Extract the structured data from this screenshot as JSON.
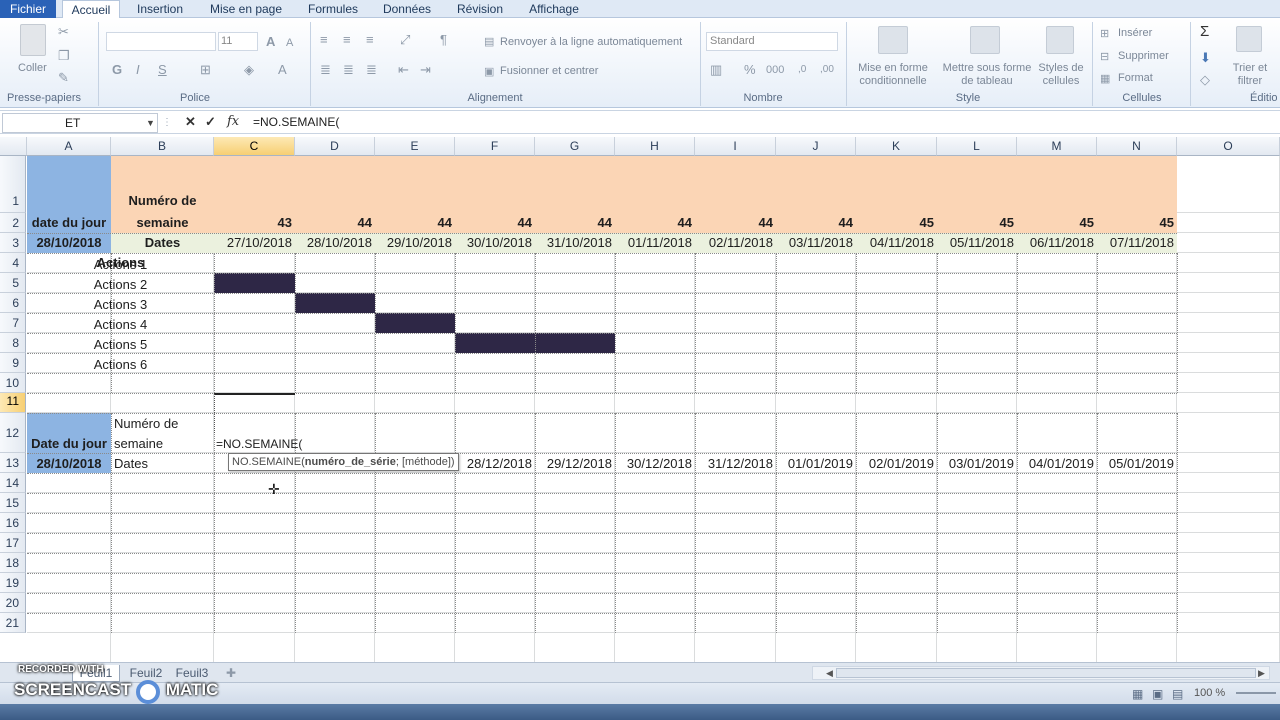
{
  "tabs": [
    "Fichier",
    "Accueil",
    "Insertion",
    "Mise en page",
    "Formules",
    "Données",
    "Révision",
    "Affichage"
  ],
  "ribbon": {
    "coller": "Coller",
    "font_size": "11",
    "wrap_text": "Renvoyer à la ligne automatiquement",
    "merge": "Fusionner et centrer",
    "number_format": "Standard",
    "cond_format": "Mise en forme\nconditionnelle",
    "table_format": "Mettre sous forme\nde tableau",
    "cell_styles": "Styles de\ncellules",
    "insert": "Insérer",
    "delete": "Supprimer",
    "format": "Format",
    "sort": "Trier et\nfiltrer",
    "groups": [
      "Presse-papiers",
      "Police",
      "Alignement",
      "Nombre",
      "Style",
      "Cellules",
      "Éditio"
    ]
  },
  "formula_bar": {
    "name_box": "ET",
    "formula": "=NO.SEMAINE("
  },
  "columns": [
    "A",
    "B",
    "C",
    "D",
    "E",
    "F",
    "G",
    "H",
    "I",
    "J",
    "K",
    "L",
    "M",
    "N",
    "O"
  ],
  "rows": [
    "1",
    "2",
    "3",
    "4",
    "5",
    "6",
    "7",
    "8",
    "9",
    "10",
    "11",
    "12",
    "13",
    "14",
    "15",
    "16",
    "17",
    "18",
    "19",
    "20",
    "21"
  ],
  "table1": {
    "a1": "date du jour",
    "a2": "28/10/2018",
    "b1_line1": "Numéro de",
    "b1_line2": "semaine",
    "b2": "Dates",
    "weeks": [
      "43",
      "44",
      "44",
      "44",
      "44",
      "44",
      "44",
      "44",
      "45",
      "45",
      "45",
      "45"
    ],
    "dates": [
      "27/10/2018",
      "28/10/2018",
      "29/10/2018",
      "30/10/2018",
      "31/10/2018",
      "01/11/2018",
      "02/11/2018",
      "03/11/2018",
      "04/11/2018",
      "05/11/2018",
      "06/11/2018",
      "07/11/2018"
    ],
    "actions_header": "Actions",
    "actions": [
      "Actions 1",
      "Actions 2",
      "Actions 3",
      "Actions 4",
      "Actions 5",
      "Actions 6"
    ]
  },
  "table2": {
    "a11": "Date du jour",
    "a12": "28/10/2018",
    "b11_line1": "Numéro de",
    "b11_line2": "semaine",
    "b12": "Dates",
    "c11": "=NO.SEMAINE(",
    "dates": [
      "28/12/2018",
      "29/12/2018",
      "30/12/2018",
      "31/12/2018",
      "01/01/2019",
      "02/01/2019",
      "03/01/2019",
      "04/01/2019",
      "05/01/2019"
    ]
  },
  "tooltip": {
    "fn": "NO.SEMAINE(",
    "arg1": "numéro_de_série",
    "sep": "; ",
    "arg2": "[méthode])"
  },
  "sheets": [
    "Feuil1",
    "Feuil2",
    "Feuil3"
  ],
  "status": {
    "zoom": "100 %"
  },
  "watermark": {
    "line1": "RECORDED WITH",
    "line2": "SCREENCAST",
    "line3": "MATIC"
  },
  "colors": {
    "header_blue": "#8db4e2",
    "header_peach": "#fbd5b5",
    "dates_green": "#ebf1de",
    "gantt": "#2e2746"
  }
}
